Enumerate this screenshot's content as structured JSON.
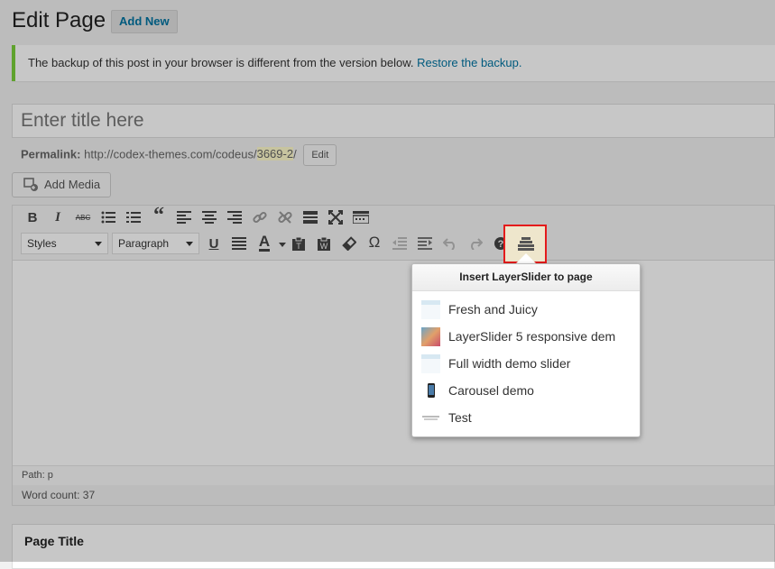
{
  "header": {
    "title": "Edit Page",
    "add_new": "Add New"
  },
  "notice": {
    "text": "The backup of this post in your browser is different from the version below. ",
    "link": "Restore the backup."
  },
  "title_input": {
    "placeholder": "Enter title here"
  },
  "permalink": {
    "label": "Permalink:",
    "base": "http://codex-themes.com/codeus/",
    "slug": "3669-2",
    "trail": "/",
    "edit": "Edit"
  },
  "add_media": "Add Media",
  "toolbar": {
    "row1": [
      "bold-icon",
      "italic-icon",
      "strikethrough-icon",
      "bullet-list-icon",
      "numbered-list-icon",
      "blockquote-icon",
      "align-left-icon",
      "align-center-icon",
      "align-right-icon",
      "insert-link-icon",
      "unlink-icon",
      "read-more-icon",
      "fullscreen-icon",
      "toolbar-toggle-icon"
    ],
    "styles_select": "Styles",
    "paragraph_select": "Paragraph",
    "row2": [
      "underline-icon",
      "justify-icon",
      "text-color-icon",
      "paste-text-icon",
      "paste-word-icon",
      "clear-formatting-icon",
      "special-character-icon",
      "outdent-icon",
      "indent-icon",
      "undo-icon",
      "redo-icon",
      "help-icon",
      "layerslider-icon"
    ]
  },
  "editor": {
    "path": "Path: p",
    "word_count": "Word count: 37"
  },
  "page_title_box": "Page Title",
  "popup": {
    "title": "Insert LayerSlider to page",
    "items": [
      {
        "label": "Fresh and Juicy",
        "thumb": "light"
      },
      {
        "label": "LayerSlider 5 responsive dem",
        "thumb": "gradient"
      },
      {
        "label": "Full width demo slider",
        "thumb": "light"
      },
      {
        "label": "Carousel demo",
        "thumb": "phone"
      },
      {
        "label": "Test",
        "thumb": "no-preview"
      }
    ]
  },
  "colors": {
    "accent_link": "#0074a2",
    "notice_border": "#7ad03a",
    "highlight_border": "#e41b1b"
  }
}
